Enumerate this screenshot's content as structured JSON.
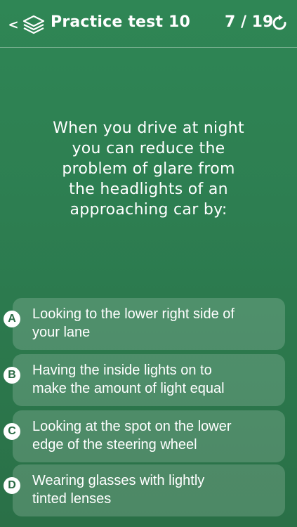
{
  "header": {
    "back_icon": "chevron-left-icon",
    "back_glyph": "<",
    "test_icon": "stack-layers-icon",
    "title": "Practice test 10",
    "progress": "7 / 19",
    "refresh_icon": "refresh-icon"
  },
  "question": {
    "lines": [
      "When you drive at night",
      "you can reduce the",
      "problem of glare from",
      "the headlights of an",
      "approaching car by:"
    ]
  },
  "answers": [
    {
      "letter": "A",
      "lines": [
        "Looking to the lower right side of",
        "your lane"
      ]
    },
    {
      "letter": "B",
      "lines": [
        "Having the inside lights on to",
        "make the amount of light equal"
      ]
    },
    {
      "letter": "C",
      "lines": [
        "Looking at the spot on the lower",
        "edge of the steering wheel"
      ]
    },
    {
      "letter": "D",
      "lines": [
        "Wearing glasses with lightly",
        "tinted lenses"
      ]
    }
  ],
  "colors": {
    "background": "#2d7e51",
    "answer_badge_text": "#2a6b44",
    "text": "#ffffff"
  }
}
